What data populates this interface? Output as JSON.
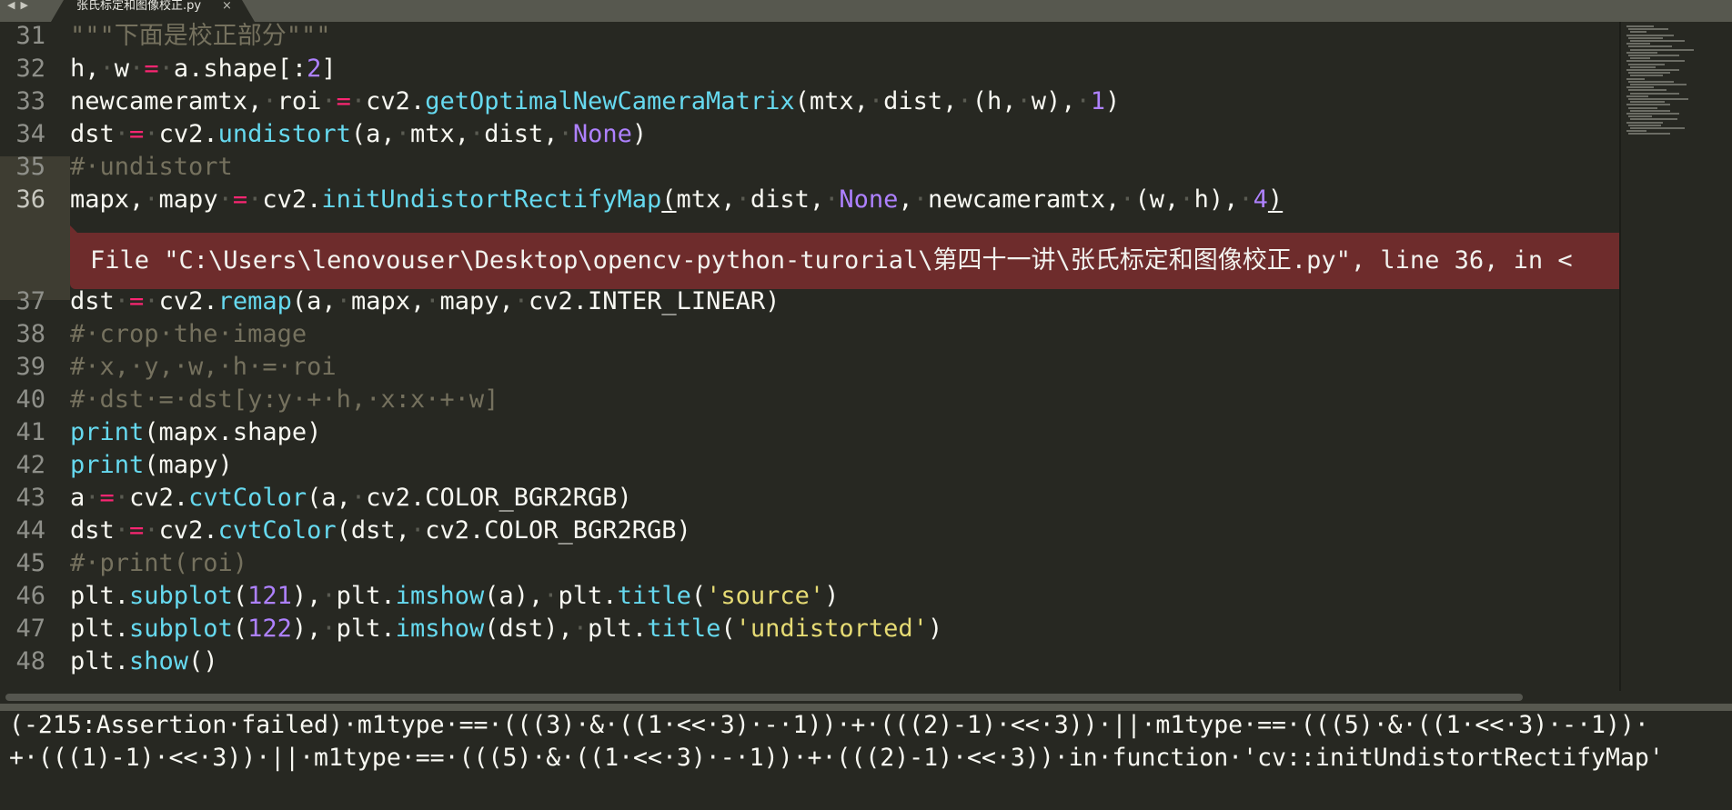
{
  "tab": {
    "nav_left": "◀",
    "nav_right": "▶",
    "filename": "张氏标定和图像校正.py",
    "close": "×"
  },
  "lines": [
    {
      "n": "31",
      "tokens": [
        [
          "cm",
          "\"\"\"下面是校正部分\"\"\""
        ]
      ]
    },
    {
      "n": "32",
      "tokens": [
        [
          "",
          "h,"
        ],
        [
          "ws",
          "·"
        ],
        [
          "",
          "w"
        ],
        [
          "ws",
          "·"
        ],
        [
          "op",
          "="
        ],
        [
          "ws",
          "·"
        ],
        [
          "",
          "a.shape[:"
        ],
        [
          "num",
          "2"
        ],
        [
          "",
          "]"
        ]
      ]
    },
    {
      "n": "33",
      "tokens": [
        [
          "",
          "newcameramtx,"
        ],
        [
          "ws",
          "·"
        ],
        [
          "",
          "roi"
        ],
        [
          "ws",
          "·"
        ],
        [
          "op",
          "="
        ],
        [
          "ws",
          "·"
        ],
        [
          "",
          "cv2."
        ],
        [
          "fn",
          "getOptimalNewCameraMatrix"
        ],
        [
          "",
          "(mtx,"
        ],
        [
          "ws",
          "·"
        ],
        [
          "",
          "dist,"
        ],
        [
          "ws",
          "·"
        ],
        [
          "",
          "(h,"
        ],
        [
          "ws",
          "·"
        ],
        [
          "",
          "w),"
        ],
        [
          "ws",
          "·"
        ],
        [
          "num",
          "1"
        ],
        [
          "",
          ")"
        ]
      ]
    },
    {
      "n": "34",
      "tokens": [
        [
          "",
          "dst"
        ],
        [
          "ws",
          "·"
        ],
        [
          "op",
          "="
        ],
        [
          "ws",
          "·"
        ],
        [
          "",
          "cv2."
        ],
        [
          "fn",
          "undistort"
        ],
        [
          "",
          "(a,"
        ],
        [
          "ws",
          "·"
        ],
        [
          "",
          "mtx,"
        ],
        [
          "ws",
          "·"
        ],
        [
          "",
          "dist,"
        ],
        [
          "ws",
          "·"
        ],
        [
          "kw",
          "None"
        ],
        [
          "",
          ")"
        ]
      ]
    },
    {
      "n": "35",
      "tokens": [
        [
          "cm",
          "#·undistort"
        ]
      ]
    },
    {
      "n": "36",
      "tokens": [
        [
          "",
          "mapx,"
        ],
        [
          "ws",
          "·"
        ],
        [
          "",
          "mapy"
        ],
        [
          "ws",
          "·"
        ],
        [
          "op",
          "="
        ],
        [
          "ws",
          "·"
        ],
        [
          "",
          "cv2."
        ],
        [
          "fn",
          "initUndistortRectifyMap"
        ],
        [
          "ul",
          "("
        ],
        [
          "",
          "mtx,"
        ],
        [
          "ws",
          "·"
        ],
        [
          "",
          "dist,"
        ],
        [
          "ws",
          "·"
        ],
        [
          "kw",
          "None"
        ],
        [
          "",
          ","
        ],
        [
          "ws",
          "·"
        ],
        [
          "",
          "newcameramtx,"
        ],
        [
          "ws",
          "·"
        ],
        [
          "",
          "(w,"
        ],
        [
          "ws",
          "·"
        ],
        [
          "",
          "h),"
        ],
        [
          "ws",
          "·"
        ],
        [
          "num",
          "4"
        ],
        [
          "ul",
          ")"
        ]
      ]
    },
    {
      "n": "37",
      "tokens": [
        [
          "",
          "dst"
        ],
        [
          "ws",
          "·"
        ],
        [
          "op",
          "="
        ],
        [
          "ws",
          "·"
        ],
        [
          "",
          "cv2."
        ],
        [
          "fn",
          "remap"
        ],
        [
          "",
          "(a,"
        ],
        [
          "ws",
          "·"
        ],
        [
          "",
          "mapx,"
        ],
        [
          "ws",
          "·"
        ],
        [
          "",
          "mapy,"
        ],
        [
          "ws",
          "·"
        ],
        [
          "",
          "cv2.INTER_LINEAR)"
        ]
      ]
    },
    {
      "n": "38",
      "tokens": [
        [
          "cm",
          "#·crop·the·image"
        ]
      ]
    },
    {
      "n": "39",
      "tokens": [
        [
          "cm",
          "#·x,·y,·w,·h·=·roi"
        ]
      ]
    },
    {
      "n": "40",
      "tokens": [
        [
          "cm",
          "#·dst·=·dst[y:y·+·h,·x:x·+·w]"
        ]
      ]
    },
    {
      "n": "41",
      "tokens": [
        [
          "fn",
          "print"
        ],
        [
          "",
          "(mapx.shape)"
        ]
      ]
    },
    {
      "n": "42",
      "tokens": [
        [
          "fn",
          "print"
        ],
        [
          "",
          "(mapy)"
        ]
      ]
    },
    {
      "n": "43",
      "tokens": [
        [
          "",
          "a"
        ],
        [
          "ws",
          "·"
        ],
        [
          "op",
          "="
        ],
        [
          "ws",
          "·"
        ],
        [
          "",
          "cv2."
        ],
        [
          "fn",
          "cvtColor"
        ],
        [
          "",
          "(a,"
        ],
        [
          "ws",
          "·"
        ],
        [
          "",
          "cv2.COLOR_BGR2RGB)"
        ]
      ]
    },
    {
      "n": "44",
      "tokens": [
        [
          "",
          "dst"
        ],
        [
          "ws",
          "·"
        ],
        [
          "op",
          "="
        ],
        [
          "ws",
          "·"
        ],
        [
          "",
          "cv2."
        ],
        [
          "fn",
          "cvtColor"
        ],
        [
          "",
          "(dst,"
        ],
        [
          "ws",
          "·"
        ],
        [
          "",
          "cv2.COLOR_BGR2RGB)"
        ]
      ]
    },
    {
      "n": "45",
      "tokens": [
        [
          "cm",
          "#·print(roi)"
        ]
      ]
    },
    {
      "n": "46",
      "tokens": [
        [
          "",
          "plt."
        ],
        [
          "fn",
          "subplot"
        ],
        [
          "",
          "("
        ],
        [
          "num",
          "121"
        ],
        [
          "",
          "),"
        ],
        [
          "ws",
          "·"
        ],
        [
          "",
          "plt."
        ],
        [
          "fn",
          "imshow"
        ],
        [
          "",
          "(a),"
        ],
        [
          "ws",
          "·"
        ],
        [
          "",
          "plt."
        ],
        [
          "fn",
          "title"
        ],
        [
          "",
          "("
        ],
        [
          "str",
          "'source'"
        ],
        [
          "",
          ")"
        ]
      ]
    },
    {
      "n": "47",
      "tokens": [
        [
          "",
          "plt."
        ],
        [
          "fn",
          "subplot"
        ],
        [
          "",
          "("
        ],
        [
          "num",
          "122"
        ],
        [
          "",
          "),"
        ],
        [
          "ws",
          "·"
        ],
        [
          "",
          "plt."
        ],
        [
          "fn",
          "imshow"
        ],
        [
          "",
          "(dst),"
        ],
        [
          "ws",
          "·"
        ],
        [
          "",
          "plt."
        ],
        [
          "fn",
          "title"
        ],
        [
          "",
          "("
        ],
        [
          "str",
          "'undistorted'"
        ],
        [
          "",
          ")"
        ]
      ]
    },
    {
      "n": "48",
      "tokens": [
        [
          "",
          "plt."
        ],
        [
          "fn",
          "show"
        ],
        [
          "",
          "()"
        ]
      ]
    }
  ],
  "error_phantom": {
    "text": "File \"C:\\Users\\lenovouser\\Desktop\\opencv-python-turorial\\第四十一讲\\张氏标定和图像校正.py\", line 36, in <"
  },
  "output": {
    "lines": [
      "(-215:Assertion·failed)·m1type·==·(((3)·&·((1·<<·3)·-·1))·+·(((2)-1)·<<·3))·||·m1type·==·(((5)·&·((1·<<·3)·-·1))·",
      "+·(((1)-1)·<<·3))·||·m1type·==·(((5)·&·((1·<<·3)·-·1))·+·(((2)-1)·<<·3))·in·function·'cv::initUndistortRectifyMap'"
    ]
  },
  "colors": {
    "background": "#272822",
    "keyword_pink": "#f92672",
    "function_blue": "#66d9ef",
    "number_purple": "#ae81ff",
    "string_yellow": "#e6db74",
    "comment_gray": "#75715e",
    "error_red": "#6e2c2c"
  }
}
